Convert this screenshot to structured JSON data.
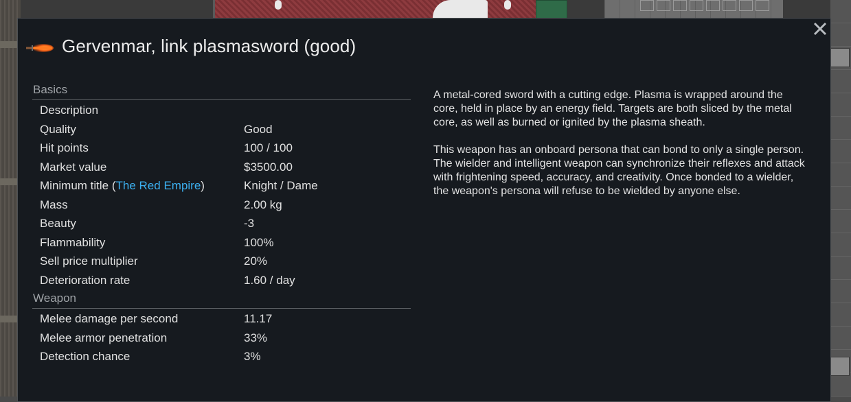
{
  "window": {
    "title": "Gervenmar, link plasmasword (good)",
    "icon": "plasmasword-icon",
    "close_icon": "close-icon"
  },
  "sections": {
    "basics": {
      "header": "Basics",
      "rows": [
        {
          "label": "Description",
          "value": ""
        },
        {
          "label": "Quality",
          "value": "Good"
        },
        {
          "label": "Hit points",
          "value": "100 / 100"
        },
        {
          "label": "Market value",
          "value": "$3500.00"
        },
        {
          "label_prefix": "Minimum title (",
          "label_link": "The Red Empire",
          "label_suffix": ")",
          "value": "Knight / Dame"
        },
        {
          "label": "Mass",
          "value": "2.00 kg"
        },
        {
          "label": "Beauty",
          "value": "-3"
        },
        {
          "label": "Flammability",
          "value": "100%"
        },
        {
          "label": "Sell price multiplier",
          "value": "20%"
        },
        {
          "label": "Deterioration rate",
          "value": "1.60 / day"
        }
      ]
    },
    "weapon": {
      "header": "Weapon",
      "rows": [
        {
          "label": "Melee damage per second",
          "value": "11.17"
        },
        {
          "label": "Melee armor penetration",
          "value": "33%"
        },
        {
          "label": "Detection chance",
          "value": "3%"
        }
      ]
    }
  },
  "description": {
    "paragraph1": "A metal-cored sword with a cutting edge. Plasma is wrapped around the core, held in place by an energy field. Targets are both sliced by the metal core, as well as burned or ignited by the plasma sheath.",
    "paragraph2": "This weapon has an onboard persona that can bond to only a single person. The wielder and intelligent weapon can synchronize their reflexes and attack with frightening speed, accuracy, and creativity. Once bonded to a wielder, the weapon's persona will refuse to be wielded by anyone else."
  },
  "colors": {
    "window_bg": "#161a1f",
    "link": "#3cb0f0",
    "header_text": "#9ea2a6",
    "body_text": "#e0e0e0"
  }
}
